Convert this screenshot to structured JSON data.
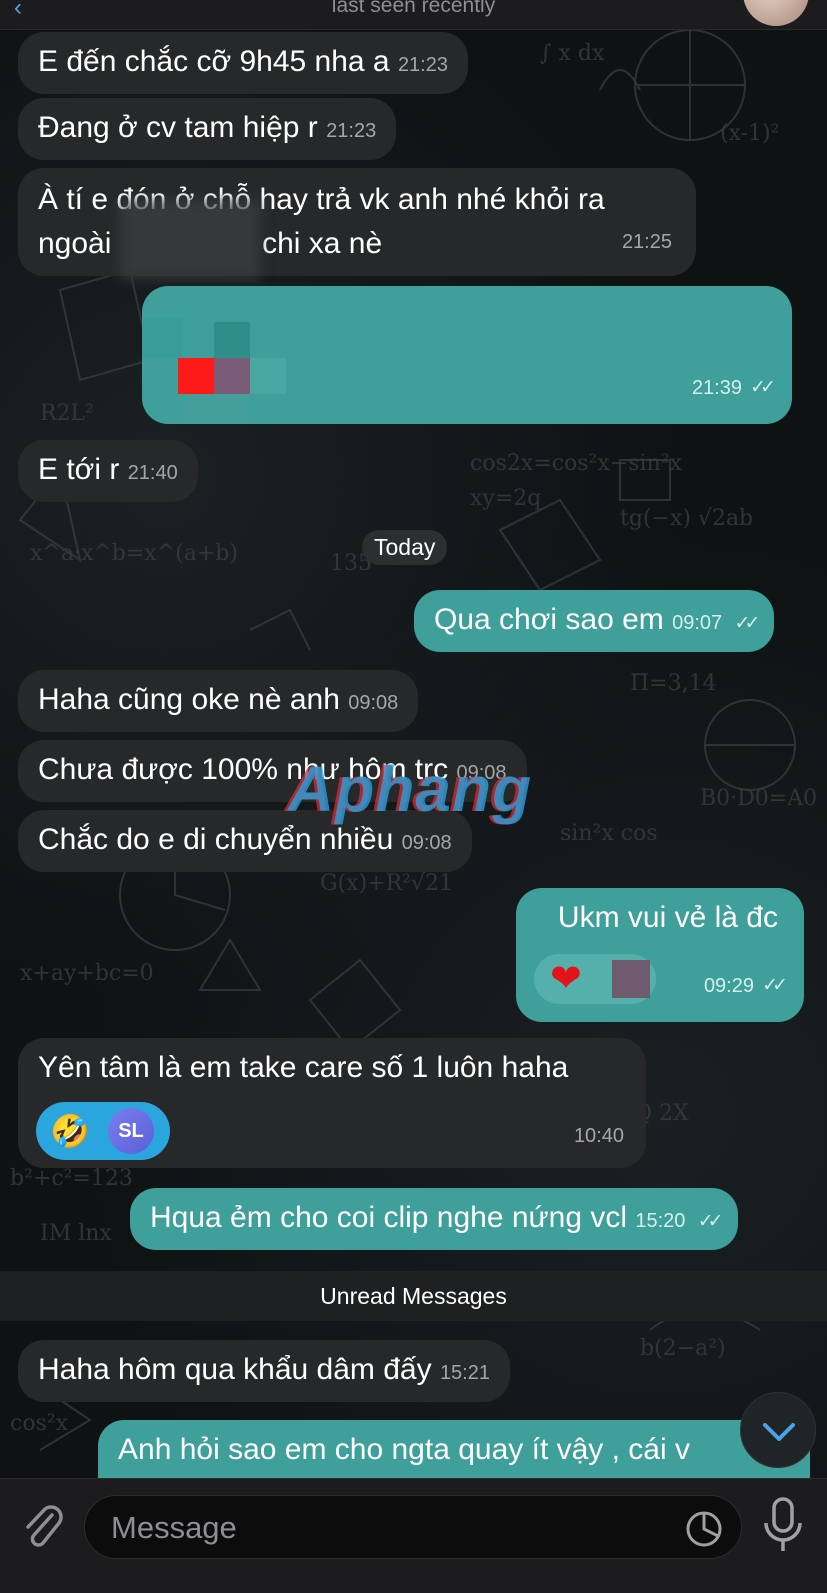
{
  "header": {
    "status": "last seen recently"
  },
  "messages": [
    {
      "id": "m1",
      "side": "in",
      "text": "E đến chắc cỡ 9h45 nha a",
      "time": "21:23"
    },
    {
      "id": "m2",
      "side": "in",
      "text": "Đang ở cv tam hiệp r",
      "time": "21:23"
    },
    {
      "id": "m3",
      "side": "in",
      "line1": "À tí e đón ở chỗ hay trả vk anh nhé khỏi ra",
      "line2": "ngoài",
      "line3": "chi xa nè",
      "time": "21:25"
    },
    {
      "id": "m4",
      "side": "out",
      "text": "",
      "time": "21:39"
    },
    {
      "id": "m5",
      "side": "in",
      "text": "E tới r",
      "time": "21:40"
    },
    {
      "id": "m6",
      "side": "out",
      "text": "Qua chơi sao em",
      "time": "09:07"
    },
    {
      "id": "m7",
      "side": "in",
      "text": "Haha cũng oke nè anh",
      "time": "09:08"
    },
    {
      "id": "m8",
      "side": "in",
      "text": "Chưa được 100% như hôm trc",
      "time": "09:08"
    },
    {
      "id": "m9",
      "side": "in",
      "text": "Chắc do e di chuyển nhiều",
      "time": "09:08"
    },
    {
      "id": "m10",
      "side": "out",
      "text": "Ukm vui vẻ là đc",
      "time": "09:29",
      "reaction": "❤"
    },
    {
      "id": "m11",
      "side": "in",
      "text": "Yên tâm là em take care số 1 luôn haha",
      "time": "10:40",
      "reaction": "🤣",
      "reaction_user": "SL"
    },
    {
      "id": "m12",
      "side": "out",
      "text": "Hqua ẻm cho coi clip nghe nứng vcl",
      "time": "15:20"
    },
    {
      "id": "m13",
      "side": "in",
      "text": "Haha hôm qua khẩu dâm đấy",
      "time": "15:21"
    },
    {
      "id": "m14",
      "side": "out",
      "text": "Anh hỏi sao em cho ngta quay ít vậy , cái v"
    }
  ],
  "day_divider": "Today",
  "unread_divider": "Unread Messages",
  "watermark": "Aphang",
  "input": {
    "placeholder": "Message"
  },
  "icons": {
    "attach": "paperclip-icon",
    "sticker": "sticker-icon",
    "mic": "microphone-icon",
    "scroll": "chevron-down-icon"
  },
  "colors": {
    "incoming": "#262829",
    "outgoing": "#3f9f9a",
    "accent": "#4aa3e8"
  }
}
